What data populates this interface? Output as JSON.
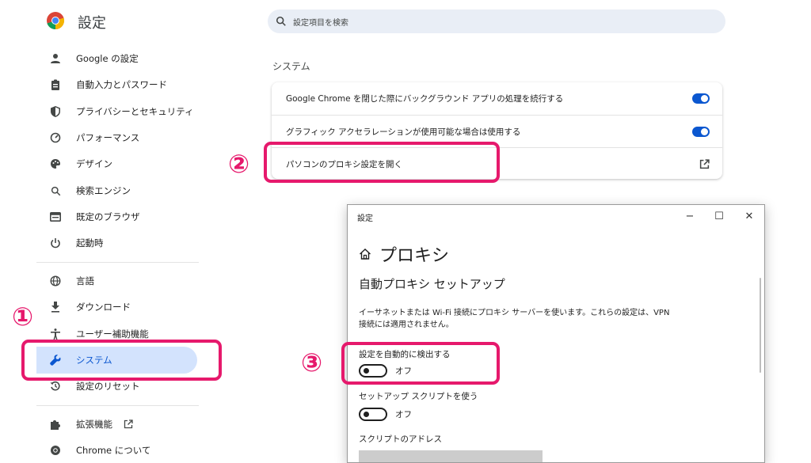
{
  "chrome": {
    "title": "設定",
    "search_placeholder": "設定項目を検索",
    "sidebar": {
      "items": [
        {
          "label": "Google の設定",
          "icon": "person-icon"
        },
        {
          "label": "自動入力とパスワード",
          "icon": "clipboard-icon"
        },
        {
          "label": "プライバシーとセキュリティ",
          "icon": "shield-icon"
        },
        {
          "label": "パフォーマンス",
          "icon": "speedometer-icon"
        },
        {
          "label": "デザイン",
          "icon": "palette-icon"
        },
        {
          "label": "検索エンジン",
          "icon": "search-icon"
        },
        {
          "label": "既定のブラウザ",
          "icon": "browser-icon"
        },
        {
          "label": "起動時",
          "icon": "power-icon"
        },
        {
          "label": "言語",
          "icon": "globe-icon"
        },
        {
          "label": "ダウンロード",
          "icon": "download-icon"
        },
        {
          "label": "ユーザー補助機能",
          "icon": "accessibility-icon"
        },
        {
          "label": "システム",
          "icon": "wrench-icon",
          "active": true
        },
        {
          "label": "設定のリセット",
          "icon": "reset-icon"
        },
        {
          "label": "拡張機能",
          "icon": "puzzle-icon"
        },
        {
          "label": "Chrome について",
          "icon": "chrome-icon"
        }
      ]
    },
    "section": {
      "heading": "システム",
      "rows": [
        {
          "label": "Google Chrome を閉じた際にバックグラウンド アプリの処理を続行する",
          "toggle": true
        },
        {
          "label": "グラフィック アクセラレーションが使用可能な場合は使用する",
          "toggle": true
        },
        {
          "label": "パソコンのプロキシ設定を開く",
          "icon": "external-link-icon"
        }
      ]
    }
  },
  "annotations": {
    "step1": "①",
    "step2": "②",
    "step3": "③",
    "color": "#e6196c"
  },
  "windows_dialog": {
    "window_title": "設定",
    "minimize": "−",
    "maximize": "☐",
    "close": "✕",
    "header": "プロキシ",
    "subheader": "自動プロキシ セットアップ",
    "description": "イーサネットまたは Wi-Fi 接続にプロキシ サーバーを使います。これらの設定は、VPN 接続には適用されません。",
    "auto_detect_label": "設定を自動的に検出する",
    "auto_detect_state": "オフ",
    "setup_script_label": "セットアップ スクリプトを使う",
    "setup_script_state": "オフ",
    "script_address_label": "スクリプトのアドレス"
  }
}
